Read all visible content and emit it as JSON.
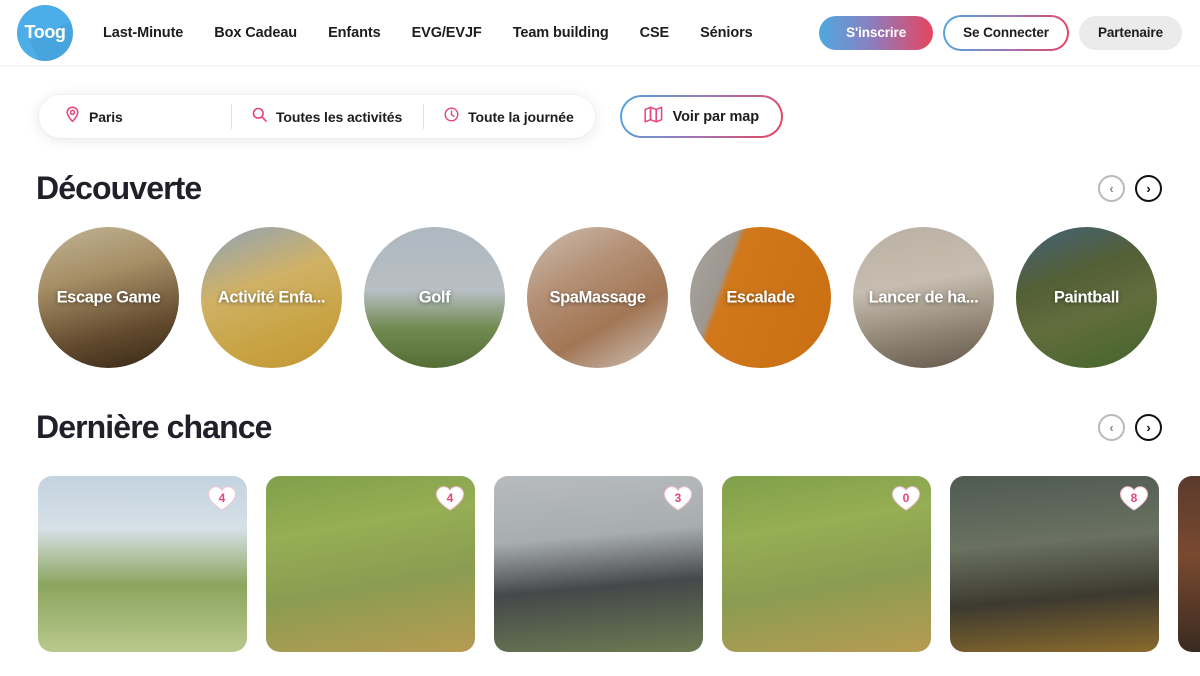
{
  "header": {
    "logo_text": "Toog",
    "nav": [
      {
        "label": "Last-Minute"
      },
      {
        "label": "Box Cadeau"
      },
      {
        "label": "Enfants"
      },
      {
        "label": "EVG/EVJF"
      },
      {
        "label": "Team building"
      },
      {
        "label": "CSE"
      },
      {
        "label": "Séniors"
      }
    ],
    "actions": {
      "signup": "S'inscrire",
      "login": "Se Connecter",
      "partner": "Partenaire"
    }
  },
  "search": {
    "location": "Paris",
    "activity": "Toutes les activités",
    "time": "Toute la journée",
    "map_button": "Voir par map",
    "icons": {
      "location": "map-pin-icon",
      "activity": "search-icon",
      "time": "clock-icon",
      "map": "map-icon"
    }
  },
  "sections": [
    {
      "title": "Découverte",
      "prev_label": "‹",
      "next_label": "›",
      "items": [
        {
          "label": "Escape Game",
          "photo": "ph-escape"
        },
        {
          "label": "Activité Enfa...",
          "photo": "ph-enfant"
        },
        {
          "label": "Golf",
          "photo": "ph-golf"
        },
        {
          "label": "SpaMassage",
          "photo": "ph-spa"
        },
        {
          "label": "Escalade",
          "photo": "ph-escalade"
        },
        {
          "label": "Lancer de ha...",
          "photo": "ph-hache"
        },
        {
          "label": "Paintball",
          "photo": "ph-paint"
        }
      ]
    },
    {
      "title": "Dernière chance",
      "prev_label": "‹",
      "next_label": "›",
      "cards": [
        {
          "badge": "4",
          "photo": "ph-c1"
        },
        {
          "badge": "4",
          "photo": "ph-c2"
        },
        {
          "badge": "3",
          "photo": "ph-c3"
        },
        {
          "badge": "0",
          "photo": "ph-c4"
        },
        {
          "badge": "8",
          "photo": "ph-c5"
        },
        {
          "badge": "",
          "photo": "ph-c6"
        }
      ]
    }
  ],
  "colors": {
    "accent_pink": "#e8447a",
    "brand_blue": "#4cade8",
    "gradient_start": "#4fa8e0",
    "gradient_end": "#e8445f"
  }
}
